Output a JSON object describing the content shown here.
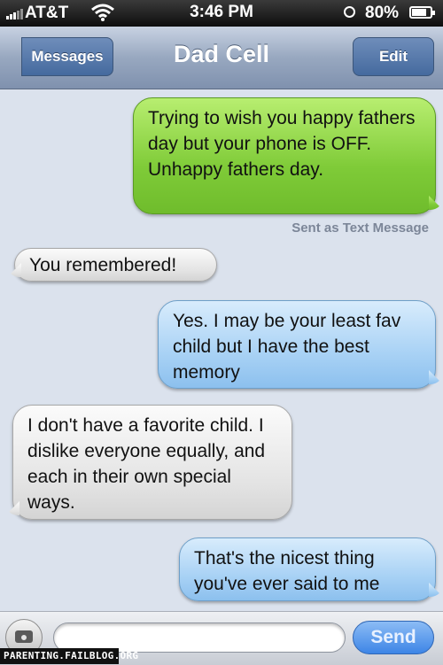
{
  "status_bar": {
    "carrier": "AT&T",
    "time": "3:46 PM",
    "battery": "80%",
    "battery_level": 0.8
  },
  "navbar": {
    "back_label": "Messages",
    "title": "Dad Cell",
    "edit_label": "Edit"
  },
  "messages": [
    {
      "from": "me",
      "text": "Trying to wish you happy fathers day but your phone is OFF. Unhappy fathers day.",
      "type": "sms"
    },
    {
      "from": "dad",
      "text": "You remembered!"
    },
    {
      "from": "me",
      "text": "Yes. I may be your least fav child but I have the best memory",
      "type": "imessage"
    },
    {
      "from": "dad",
      "text": "I don't have a favorite child. I dislike everyone equally, and each in their own special ways."
    },
    {
      "from": "me",
      "text": "That's the nicest thing you've ever said to me",
      "type": "imessage"
    }
  ],
  "sent_note": "Sent as Text Message",
  "input": {
    "placeholder": "",
    "send_label": "Send"
  },
  "watermark": "PARENTING.FAILBLOG.ORG",
  "colors": {
    "sms_bubble": "#8fd94a",
    "imessage_bubble": "#a9d2f5",
    "received_bubble": "#e6e6e6",
    "background": "#dbe2ed"
  }
}
